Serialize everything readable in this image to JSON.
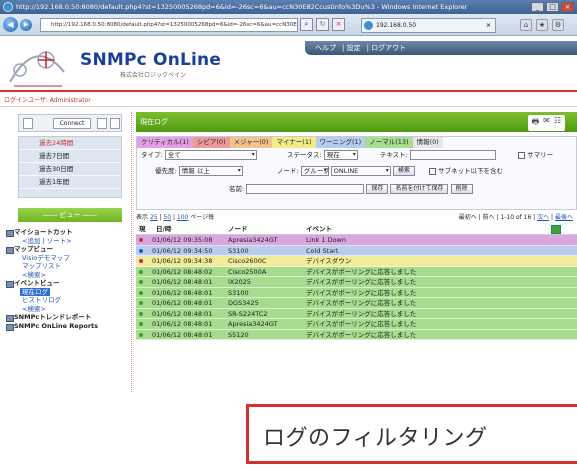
{
  "browser": {
    "title": "http://192.168.0.50:8080/default.php4?st=13250005268pd=6&id=-26sc=6&au=ccN30E82Ccustinfo%3Du%3 - Windows Internet Explorer",
    "address": "http://192.168.0.50:8080/default.php4?st=13250005268pd=6&id=-26sc=6&au=ccN30E82Ccu",
    "tab_label": "192.168.0.50",
    "window_buttons": [
      "_",
      "□",
      "×"
    ],
    "nav_back": "◀",
    "nav_fwd": "▶",
    "search_glyph": "⌕",
    "refresh_glyph": "↻",
    "stop_glyph": "×",
    "tool_glyphs": [
      "⌂",
      "★",
      "⚙"
    ]
  },
  "app": {
    "title": "SNMPc OnLine",
    "company": "株式会社ロジックベイン",
    "links": [
      "ヘルプ",
      "設定",
      "ログアウト"
    ],
    "user": "ログインユーザ: Administrator"
  },
  "sidebar": {
    "tools": [
      "Connect"
    ],
    "time_ranges": [
      "過去24時間",
      "過去7日間",
      "過去30日間",
      "過去1年間"
    ],
    "view_label": "―― ビュー ――",
    "tree": [
      {
        "head": "マイショートカット",
        "subs": [
          "<追加 | ソート>"
        ]
      },
      {
        "head": "マップビュー",
        "subs": [
          "Visioデモマップ",
          "マップリスト",
          "<検索>"
        ]
      },
      {
        "head": "イベントビュー",
        "subs": [
          "現在ログ",
          "ヒストリログ",
          "<検索>"
        ]
      },
      {
        "head": "SNMPcトレンドレポート",
        "subs": []
      },
      {
        "head": "SNMPc OnLine Reports",
        "subs": []
      }
    ]
  },
  "main": {
    "page_title": "現在ログ",
    "page_icons": [
      "🖶",
      "✉",
      "☷"
    ],
    "severity_tabs": [
      {
        "label": "クリティカル(1)",
        "color": "#e3a0e6"
      },
      {
        "label": "シビア(0)",
        "color": "#ef9a9a"
      },
      {
        "label": "メジャー(0)",
        "color": "#f2c590"
      },
      {
        "label": "マイナー(1)",
        "color": "#f3ea8a"
      },
      {
        "label": "ワーニング(1)",
        "color": "#b6ccef"
      },
      {
        "label": "ノーマル(13)",
        "color": "#a8de8f"
      },
      {
        "label": "情報(0)",
        "color": "#e8e8e8"
      }
    ],
    "filter": {
      "type_label": "タイプ:",
      "type_value": "全て",
      "status_label": "ステータス:",
      "status_value": "現在",
      "text_label": "テキスト:",
      "summary_label": "サマリー",
      "priority_label": "優先度:",
      "priority_value": "情報 以上",
      "node_label": "ノード:",
      "node_type": "グループ",
      "node_value": "ONLINE",
      "search_btn": "検索",
      "subnet_label": "サブネット以下を含む",
      "name_label": "名前:",
      "save_btn": "保存",
      "save_as_btn": "名前を付けて保存",
      "delete_btn": "削除"
    },
    "pager": {
      "show_prefix": "表示",
      "sizes": [
        "25",
        "50",
        "100"
      ],
      "per_page": "ページ毎",
      "nav": "最初へ | 前へ | 1-10 of 16 |",
      "next": "次へ",
      "last": "最後へ"
    },
    "columns": [
      "現在",
      "日/時",
      "ノード",
      "イベント"
    ],
    "rows": [
      {
        "dot": "#cc2266",
        "bg": "#d9a7e0",
        "time": "01/06/12 09:35:08",
        "node": "Apresia3424GT",
        "event": "Link 1 Down"
      },
      {
        "dot": "#1a5fb8",
        "bg": "#b9cdef",
        "time": "01/06/12 09:34:50",
        "node": "S3100",
        "event": "Cold Start"
      },
      {
        "dot": "#cc2266",
        "bg": "#f1ec99",
        "time": "01/06/12 09:34:38",
        "node": "Cisco2600C",
        "event": "デバイスダウン"
      },
      {
        "dot": "#3aa02a",
        "bg": "#a6dc8d",
        "time": "01/06/12 08:48:02",
        "node": "Cisco2500A",
        "event": "デバイスがポーリングに応答しました"
      },
      {
        "dot": "#3aa02a",
        "bg": "#a6dc8d",
        "time": "01/06/12 08:48:01",
        "node": "IX2025",
        "event": "デバイスがポーリングに応答しました"
      },
      {
        "dot": "#3aa02a",
        "bg": "#a6dc8d",
        "time": "01/06/12 08:48:01",
        "node": "S3100",
        "event": "デバイスがポーリングに応答しました"
      },
      {
        "dot": "#3aa02a",
        "bg": "#a6dc8d",
        "time": "01/06/12 08:48:01",
        "node": "DGS3425",
        "event": "デバイスがポーリングに応答しました"
      },
      {
        "dot": "#3aa02a",
        "bg": "#a6dc8d",
        "time": "01/06/12 08:48:01",
        "node": "SR-S224TC2",
        "event": "デバイスがポーリングに応答しました"
      },
      {
        "dot": "#3aa02a",
        "bg": "#a6dc8d",
        "time": "01/06/12 08:48:01",
        "node": "Apresia3424GT",
        "event": "デバイスがポーリングに応答しました"
      },
      {
        "dot": "#3aa02a",
        "bg": "#a6dc8d",
        "time": "01/06/12 08:48:01",
        "node": "S5120",
        "event": "デバイスがポーリングに応答しました"
      }
    ]
  },
  "caption": "ログのフィルタリング"
}
